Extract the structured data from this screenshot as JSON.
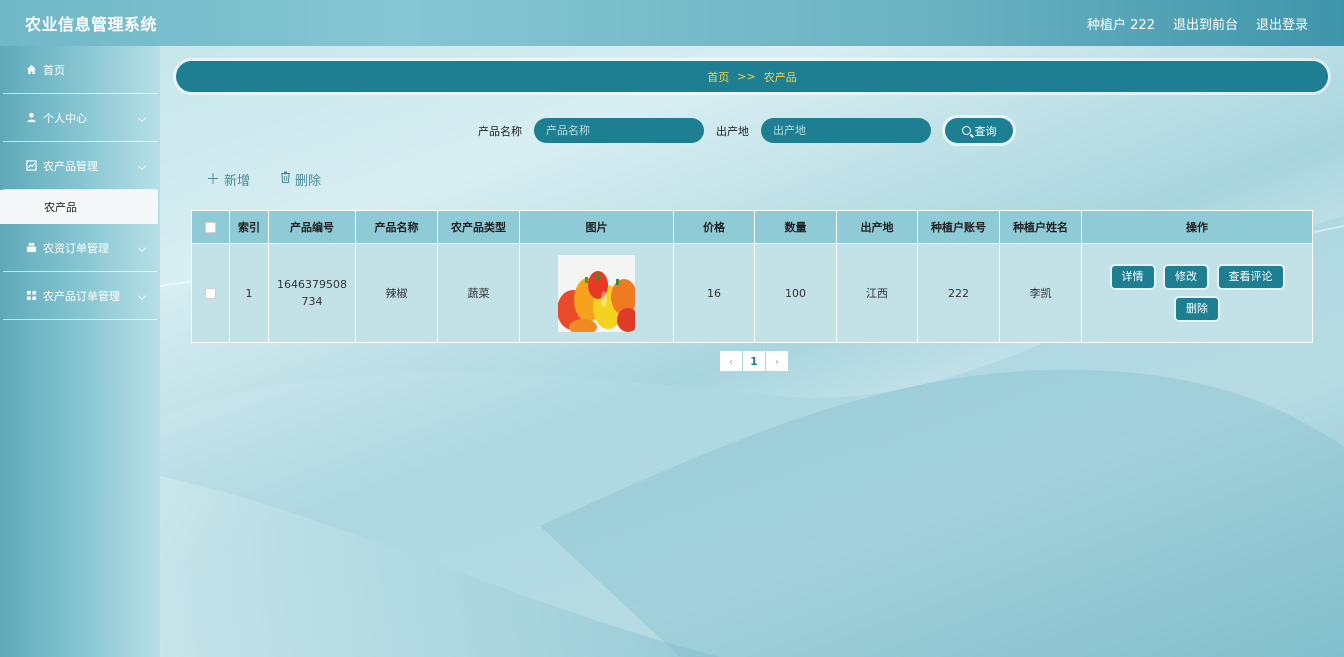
{
  "header": {
    "title": "农业信息管理系统",
    "user": "种植户 222",
    "front_link": "退出到前台",
    "logout": "退出登录"
  },
  "sidebar": {
    "items": [
      {
        "label": "首页",
        "icon": "home-icon"
      },
      {
        "label": "个人中心",
        "icon": "user-icon"
      },
      {
        "label": "农产品管理",
        "icon": "chart-icon"
      },
      {
        "label": "农资订单管理",
        "icon": "stack-icon"
      },
      {
        "label": "农产品订单管理",
        "icon": "grid-icon"
      }
    ],
    "submenu": {
      "label": "农产品"
    }
  },
  "breadcrumb": {
    "home": "首页",
    "sep": ">>",
    "current": "农产品"
  },
  "search": {
    "name_label": "产品名称",
    "name_placeholder": "产品名称",
    "origin_label": "出产地",
    "origin_placeholder": "出产地",
    "button": "查询"
  },
  "actions": {
    "add": "新增",
    "delete": "删除"
  },
  "table": {
    "columns": [
      "索引",
      "产品编号",
      "产品名称",
      "农产品类型",
      "图片",
      "价格",
      "数量",
      "出产地",
      "种植户账号",
      "种植户姓名",
      "操作"
    ],
    "rows": [
      {
        "index": "1",
        "code": "1646379508734",
        "name": "辣椒",
        "type": "蔬菜",
        "price": "16",
        "qty": "100",
        "origin": "江西",
        "account": "222",
        "farmer": "李凯",
        "ops": [
          "详情",
          "修改",
          "查看评论",
          "删除"
        ]
      }
    ]
  },
  "pagination": {
    "prev": "‹",
    "current": "1",
    "next": "›"
  },
  "colors": {
    "primary": "#1e7f93",
    "breadcrumb_text": "#f3d34a",
    "table_header": "#8fcad7",
    "table_row": "#c3e2e8"
  }
}
